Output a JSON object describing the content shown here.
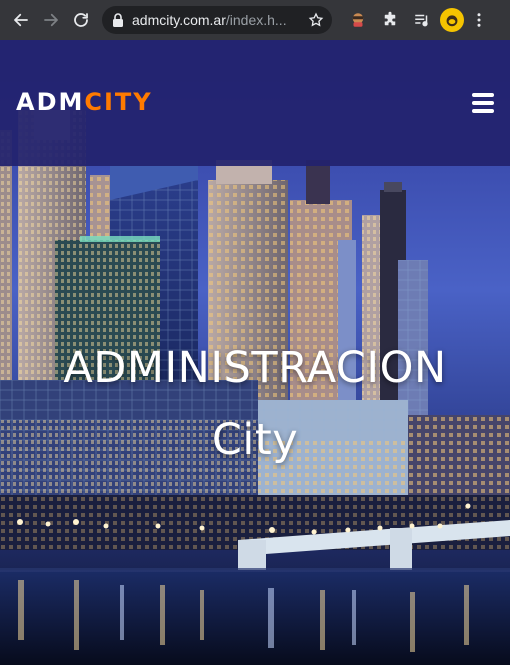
{
  "browser": {
    "url_host": "admcity.com.ar",
    "url_path": "/index.h...",
    "back_icon": "arrow-left-icon",
    "forward_icon": "arrow-right-icon",
    "reload_icon": "reload-icon",
    "lock_icon": "lock-icon",
    "bookmark_icon": "star-icon",
    "extensions": [
      "extension-avatar-icon",
      "puzzle-icon",
      "media-queue-icon"
    ],
    "profile_icon": "profile-avatar-icon",
    "menu_icon": "more-vertical-icon"
  },
  "site": {
    "logo_part1": "ADM",
    "logo_part2": "CITY",
    "menu_icon": "hamburger-menu-icon",
    "hero_line1": "ADMINISTRACION",
    "hero_line2": "City"
  },
  "colors": {
    "header_bg": "#22226e",
    "logo_accent": "#ff7a00",
    "hero_text": "#ffffff"
  }
}
